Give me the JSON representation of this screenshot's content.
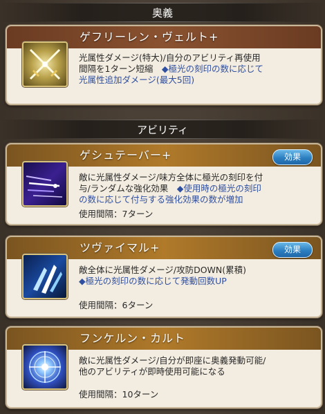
{
  "sections": {
    "ougi_header": "奥義",
    "ability_header": "アビリティ"
  },
  "ougi": {
    "name": "ゲフリーレン・ヴェルト+",
    "desc_line1": "光属性ダメージ(特大)/自分のアビリティ再使用",
    "desc_line2_a": "間隔を1ターン短縮　",
    "desc_line2_b": "◆極光の刻印の数に応じて",
    "desc_line3": "光属性追加ダメージ(最大5回)",
    "icon": "crossed-swords-icon"
  },
  "abilities": [
    {
      "name": "ゲシュテーバー+",
      "effect_label": "効果",
      "desc_line1": "敵に光属性ダメージ/味方全体に極光の刻印を付",
      "desc_line2_a": "与/ランダムな強化効果　",
      "desc_line2_b": "◆使用時の極光の刻印",
      "desc_line3": "の数に応じて付与する強化効果の数が増加",
      "cooldown": "使用間隔：7ターン",
      "icon": "light-streaks-icon"
    },
    {
      "name": "ツヴァイマル+",
      "effect_label": "効果",
      "desc_line1": "敵全体に光属性ダメージ/攻防DOWN(累積)",
      "desc_line2": "◆極光の刻印の数に応じて発動回数UP",
      "cooldown": "使用間隔：6ターン",
      "icon": "ice-shards-icon"
    },
    {
      "name": "フンケルン・カルト",
      "desc_line1": "敵に光属性ダメージ/自分が即座に奥義発動可能/",
      "desc_line2": "他のアビリティが即時使用可能になる",
      "cooldown": "使用間隔：10ターン",
      "icon": "star-burst-icon"
    }
  ]
}
